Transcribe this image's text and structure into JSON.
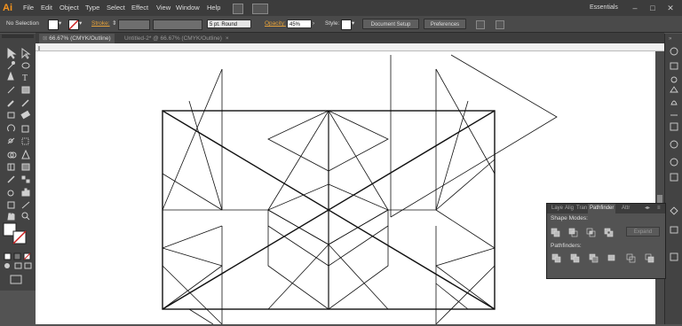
{
  "app": {
    "logo_text": "Ai"
  },
  "menu": [
    "File",
    "Edit",
    "Object",
    "Type",
    "Select",
    "Effect",
    "View",
    "Window",
    "Help"
  ],
  "workspace": "Essentials",
  "window_controls": [
    "–",
    "□",
    "✕"
  ],
  "control": {
    "selection": "No Selection",
    "stroke_label": "Stroke:",
    "brush_value": "5 pt. Round",
    "opacity_label": "Opacity:",
    "opacity_value": "45%",
    "style_label": "Style:",
    "document_setup": "Document Setup",
    "preferences": "Preferences",
    "fill_color": "#ffffff",
    "stroke_color": "#cc2020"
  },
  "tabs": [
    {
      "label": "66.67% (CMYK/Outline)",
      "active": true
    },
    {
      "label": "Untitled-2* @ 66.67% (CMYK/Outline)",
      "active": false
    }
  ],
  "pathfinder": {
    "tabs": [
      "Laye",
      "Alig",
      "Tran",
      "Pathfinder",
      "Attr"
    ],
    "shape_modes_label": "Shape Modes:",
    "pathfinders_label": "Pathfinders:",
    "expand_label": "Expand"
  }
}
